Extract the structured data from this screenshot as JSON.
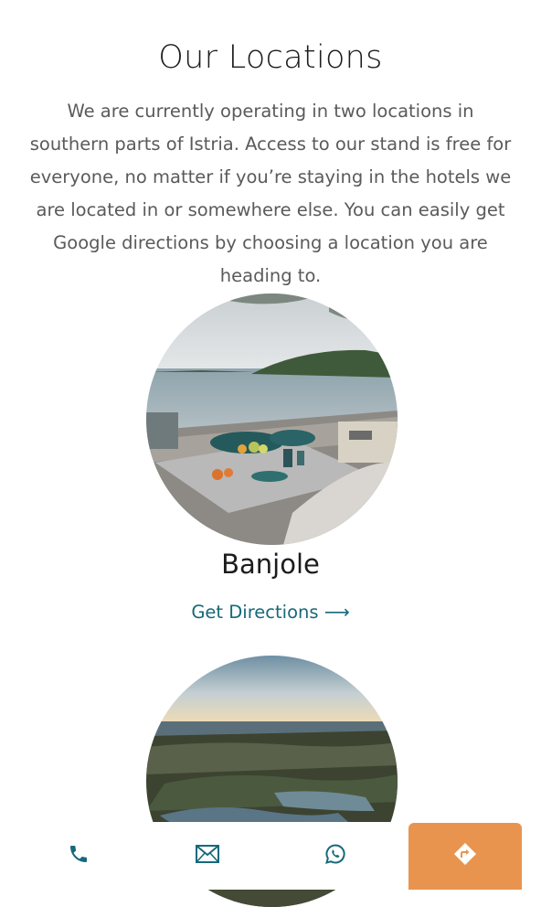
{
  "section": {
    "title": "Our Locations",
    "intro": "We are currently operating in two locations in southern parts of Istria.  Access to our stand is free for everyone, no matter if you’re staying in the hotels we are located in or somewhere else. You can easily get Google directions by choosing a location you are heading to."
  },
  "locations": [
    {
      "name": "Banjole",
      "link_label": "Get Directions ⟶"
    },
    {
      "name": "",
      "link_label": ""
    }
  ],
  "bottom_bar": {
    "icons": [
      "phone-icon",
      "envelope-icon",
      "whatsapp-icon",
      "directions-icon"
    ],
    "accent_color": "#e8944f",
    "icon_color": "#17697a"
  }
}
